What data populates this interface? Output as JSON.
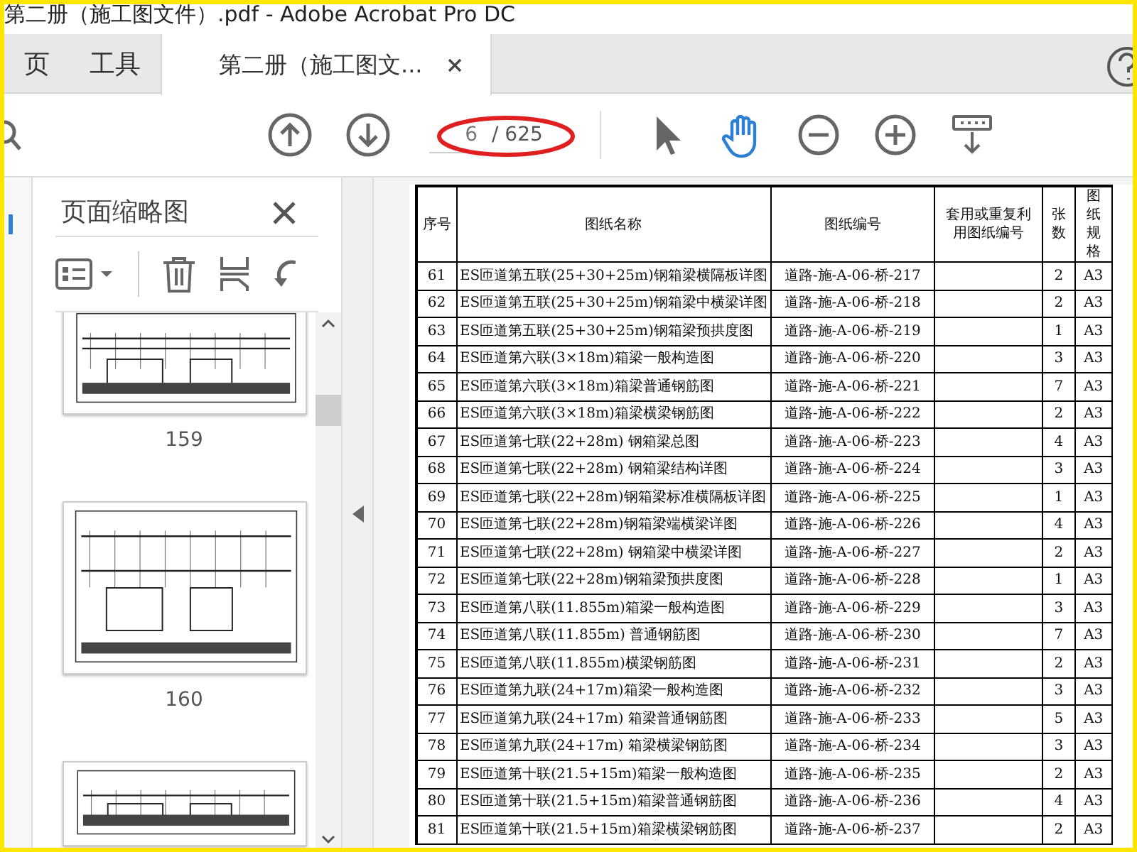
{
  "window": {
    "title": "第二册（施工图文件）.pdf - Adobe Acrobat Pro DC"
  },
  "tabs": [
    {
      "label": "页",
      "selected": false
    },
    {
      "label": "工具",
      "selected": false
    },
    {
      "label": "第二册（施工图文...",
      "selected": true
    }
  ],
  "toolbar": {
    "page_field": {
      "value": "6"
    },
    "page_total": "/ 625",
    "tools": [
      {
        "kind": "prev",
        "selected": false
      },
      {
        "kind": "next",
        "selected": false
      },
      {
        "kind": "page"
      },
      {
        "kind": "pointer",
        "selected": false
      },
      {
        "kind": "hand",
        "selected": true
      },
      {
        "kind": "zoom-out",
        "selected": false
      },
      {
        "kind": "zoom-in",
        "selected": false
      },
      {
        "kind": "more",
        "selected": false
      }
    ]
  },
  "thumbnails_panel": {
    "title": "页面缩略图",
    "thumbnails": [
      {
        "label": "159",
        "selected": false
      },
      {
        "label": "160",
        "selected": false
      },
      {
        "selected": false
      }
    ]
  },
  "table": {
    "columns": [
      "序号",
      "图纸名称",
      "图纸编号",
      "套用或重复利用图纸编号",
      "张数",
      "图纸规格"
    ],
    "rows": [
      {
        "no": "61",
        "name": "ES匝道第五联(25+30+25m)钢箱梁横隔板详图",
        "code": "道路-施-A-06-桥-217",
        "sheets": "2",
        "size": "A3"
      },
      {
        "no": "62",
        "name": "ES匝道第五联(25+30+25m)钢箱梁中横梁详图",
        "code": "道路-施-A-06-桥-218",
        "sheets": "2",
        "size": "A3"
      },
      {
        "no": "63",
        "name": "ES匝道第五联(25+30+25m)钢箱梁预拱度图",
        "code": "道路-施-A-06-桥-219",
        "sheets": "1",
        "size": "A3"
      },
      {
        "no": "64",
        "name": "ES匝道第六联(3×18m)箱梁一般构造图",
        "code": "道路-施-A-06-桥-220",
        "sheets": "3",
        "size": "A3"
      },
      {
        "no": "65",
        "name": "ES匝道第六联(3×18m)箱梁普通钢筋图",
        "code": "道路-施-A-06-桥-221",
        "sheets": "7",
        "size": "A3"
      },
      {
        "no": "66",
        "name": "ES匝道第六联(3×18m)箱梁横梁钢筋图",
        "code": "道路-施-A-06-桥-222",
        "sheets": "2",
        "size": "A3"
      },
      {
        "no": "67",
        "name": "ES匝道第七联(22+28m) 钢箱梁总图",
        "code": "道路-施-A-06-桥-223",
        "sheets": "4",
        "size": "A3"
      },
      {
        "no": "68",
        "name": "ES匝道第七联(22+28m) 钢箱梁结构详图",
        "code": "道路-施-A-06-桥-224",
        "sheets": "3",
        "size": "A3"
      },
      {
        "no": "69",
        "name": "ES匝道第七联(22+28m)钢箱梁标准横隔板详图",
        "code": "道路-施-A-06-桥-225",
        "sheets": "1",
        "size": "A3"
      },
      {
        "no": "70",
        "name": "ES匝道第七联(22+28m)钢箱梁端横梁详图",
        "code": "道路-施-A-06-桥-226",
        "sheets": "4",
        "size": "A3"
      },
      {
        "no": "71",
        "name": "ES匝道第七联(22+28m) 钢箱梁中横梁详图",
        "code": "道路-施-A-06-桥-227",
        "sheets": "2",
        "size": "A3"
      },
      {
        "no": "72",
        "name": "ES匝道第七联(22+28m)钢箱梁预拱度图",
        "code": "道路-施-A-06-桥-228",
        "sheets": "1",
        "size": "A3"
      },
      {
        "no": "73",
        "name": "ES匝道第八联(11.855m)箱梁一般构造图",
        "code": "道路-施-A-06-桥-229",
        "sheets": "3",
        "size": "A3"
      },
      {
        "no": "74",
        "name": "ES匝道第八联(11.855m) 普通钢筋图",
        "code": "道路-施-A-06-桥-230",
        "sheets": "7",
        "size": "A3"
      },
      {
        "no": "75",
        "name": "ES匝道第八联(11.855m)横梁钢筋图",
        "code": "道路-施-A-06-桥-231",
        "sheets": "2",
        "size": "A3"
      },
      {
        "no": "76",
        "name": "ES匝道第九联(24+17m)箱梁一般构造图",
        "code": "道路-施-A-06-桥-232",
        "sheets": "3",
        "size": "A3"
      },
      {
        "no": "77",
        "name": "ES匝道第九联(24+17m) 箱梁普通钢筋图",
        "code": "道路-施-A-06-桥-233",
        "sheets": "5",
        "size": "A3"
      },
      {
        "no": "78",
        "name": "ES匝道第九联(24+17m) 箱梁横梁钢筋图",
        "code": "道路-施-A-06-桥-234",
        "sheets": "3",
        "size": "A3"
      },
      {
        "no": "79",
        "name": "ES匝道第十联(21.5+15m)箱梁一般构造图",
        "code": "道路-施-A-06-桥-235",
        "sheets": "2",
        "size": "A3"
      },
      {
        "no": "80",
        "name": "ES匝道第十联(21.5+15m)箱梁普通钢筋图",
        "code": "道路-施-A-06-桥-236",
        "sheets": "4",
        "size": "A3"
      },
      {
        "no": "81",
        "name": "ES匝道第十联(21.5+15m)箱梁横梁钢筋图",
        "code": "道路-施-A-06-桥-237",
        "sheets": "2",
        "size": "A3"
      }
    ]
  }
}
